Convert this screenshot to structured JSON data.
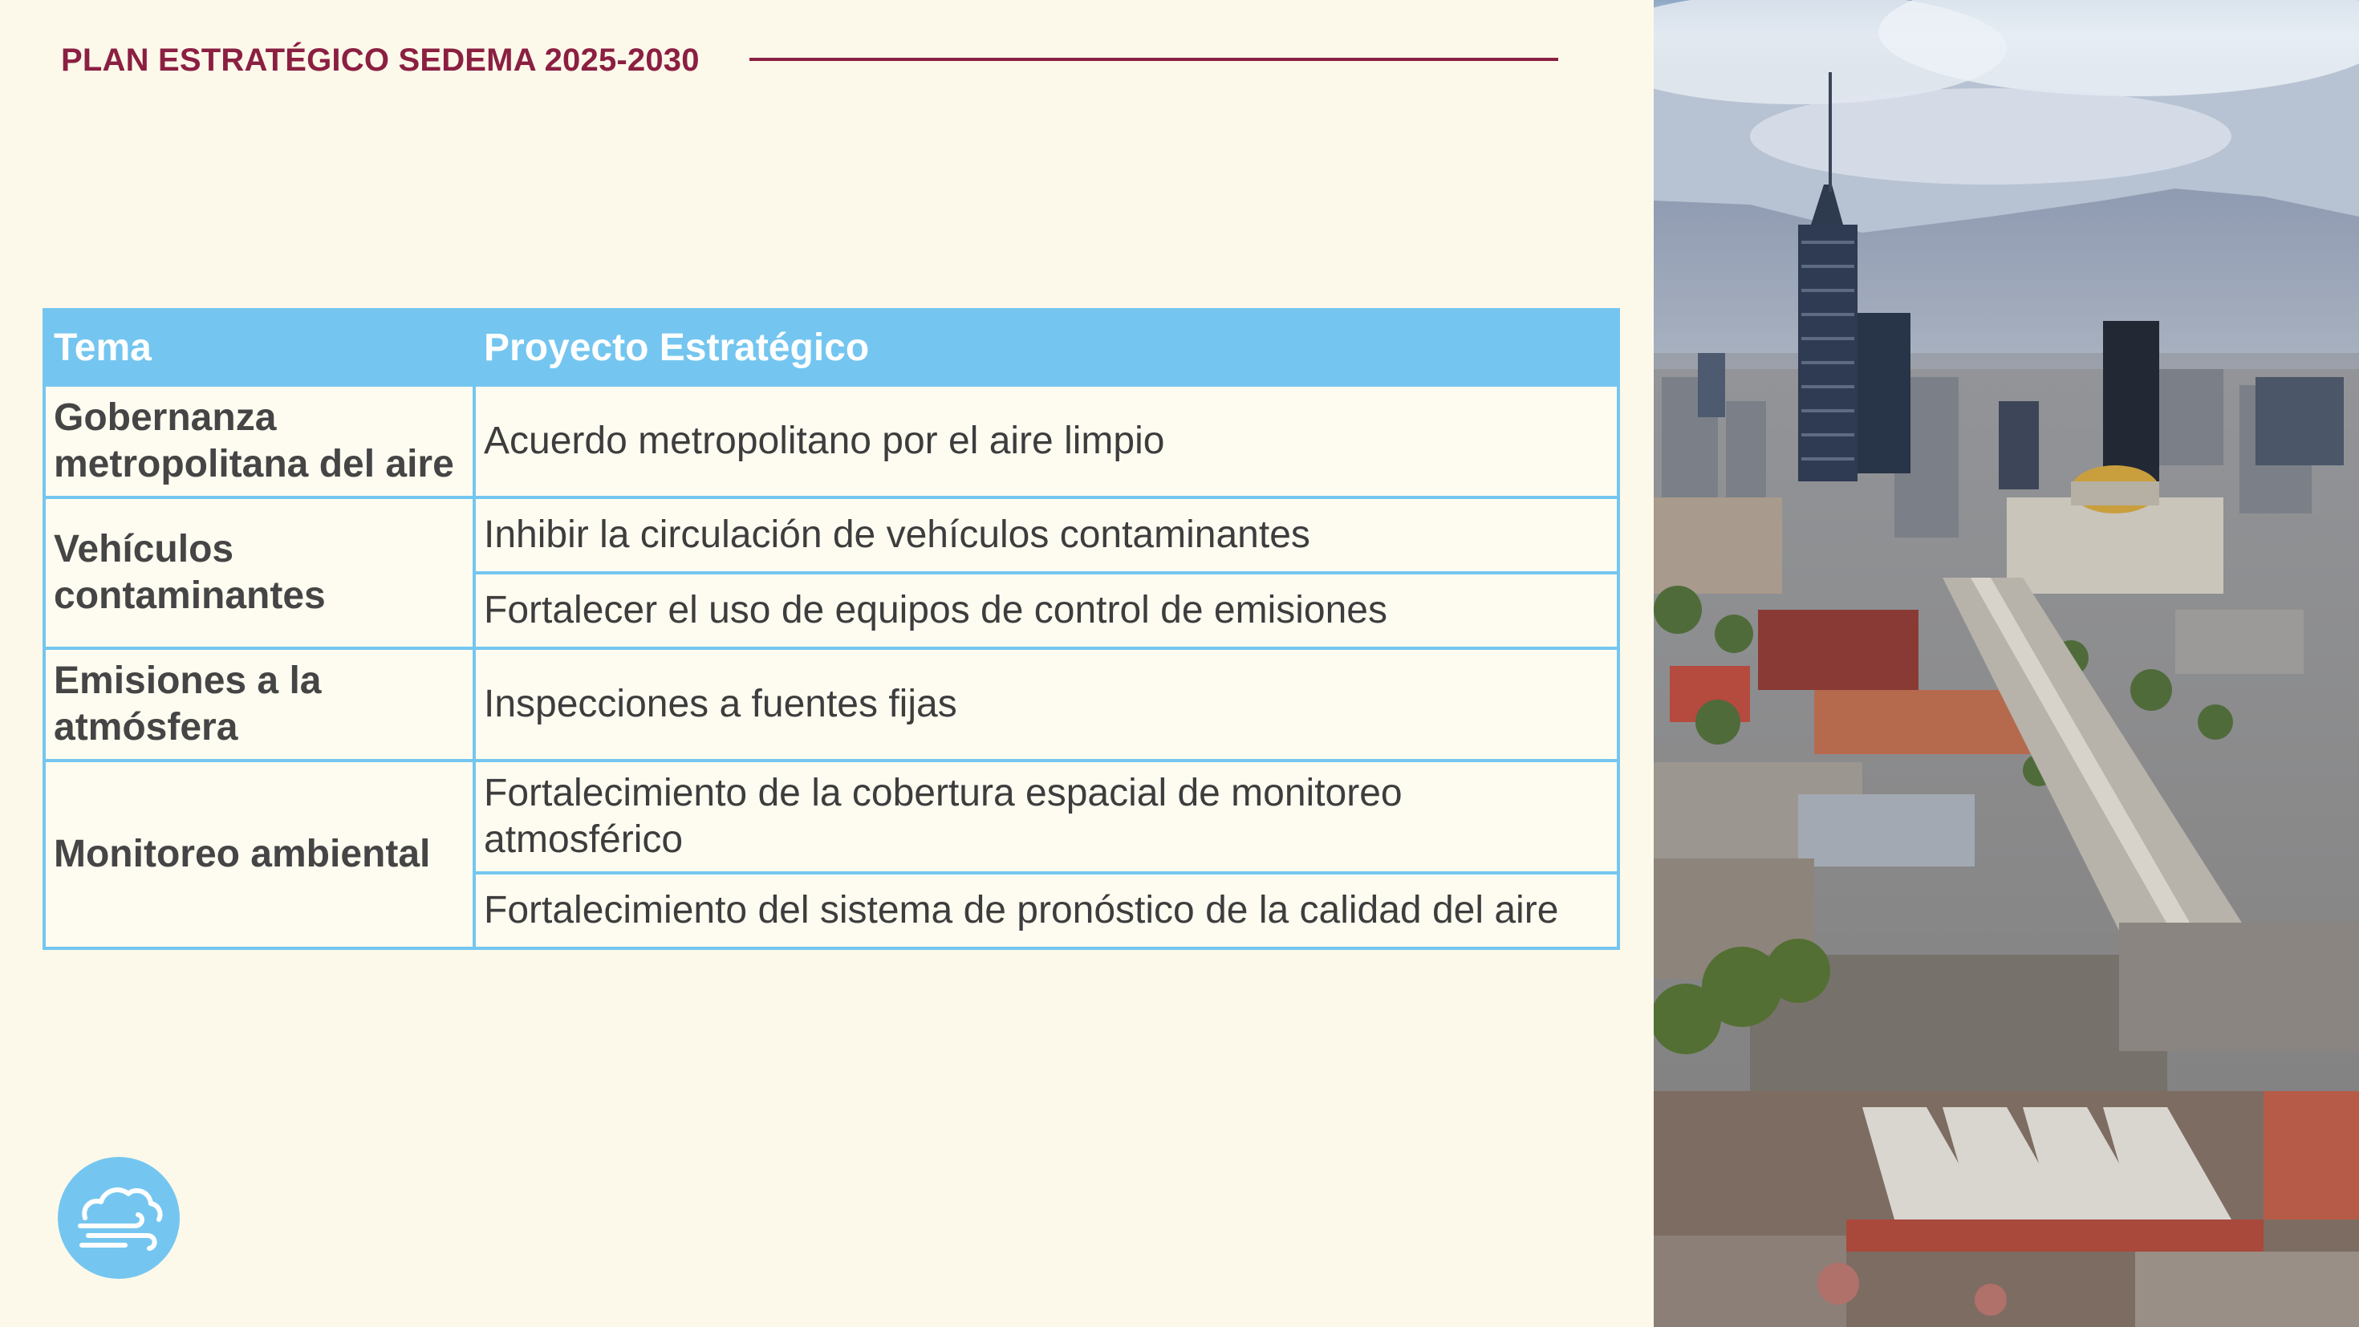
{
  "header": {
    "title": "PLAN ESTRATÉGICO SEDEMA 2025-2030"
  },
  "table": {
    "columns": [
      "Tema",
      "Proyecto Estratégico"
    ],
    "rows": [
      {
        "topic": "Gobernanza metropolitana del aire",
        "projects": [
          "Acuerdo metropolitano por el aire limpio"
        ]
      },
      {
        "topic": "Vehículos contaminantes",
        "projects": [
          "Inhibir la circulación de vehículos contaminantes",
          "Fortalecer el uso de equipos de control de emisiones"
        ]
      },
      {
        "topic": "Emisiones a la atmósfera",
        "projects": [
          "Inspecciones a fuentes fijas"
        ]
      },
      {
        "topic": "Monitoreo ambiental",
        "projects": [
          "Fortalecimiento de la cobertura espacial de monitoreo atmosférico",
          "Fortalecimiento del sistema de pronóstico de la calidad del aire"
        ]
      }
    ]
  },
  "photo": {
    "icon": "city-skyline-photo"
  },
  "logo": {
    "icon": "cloud-wind-icon"
  },
  "colors": {
    "background": "#fcf9ea",
    "accent": "#8b1f42",
    "table_header": "#74c6f0",
    "text": "#3d3d3d"
  }
}
